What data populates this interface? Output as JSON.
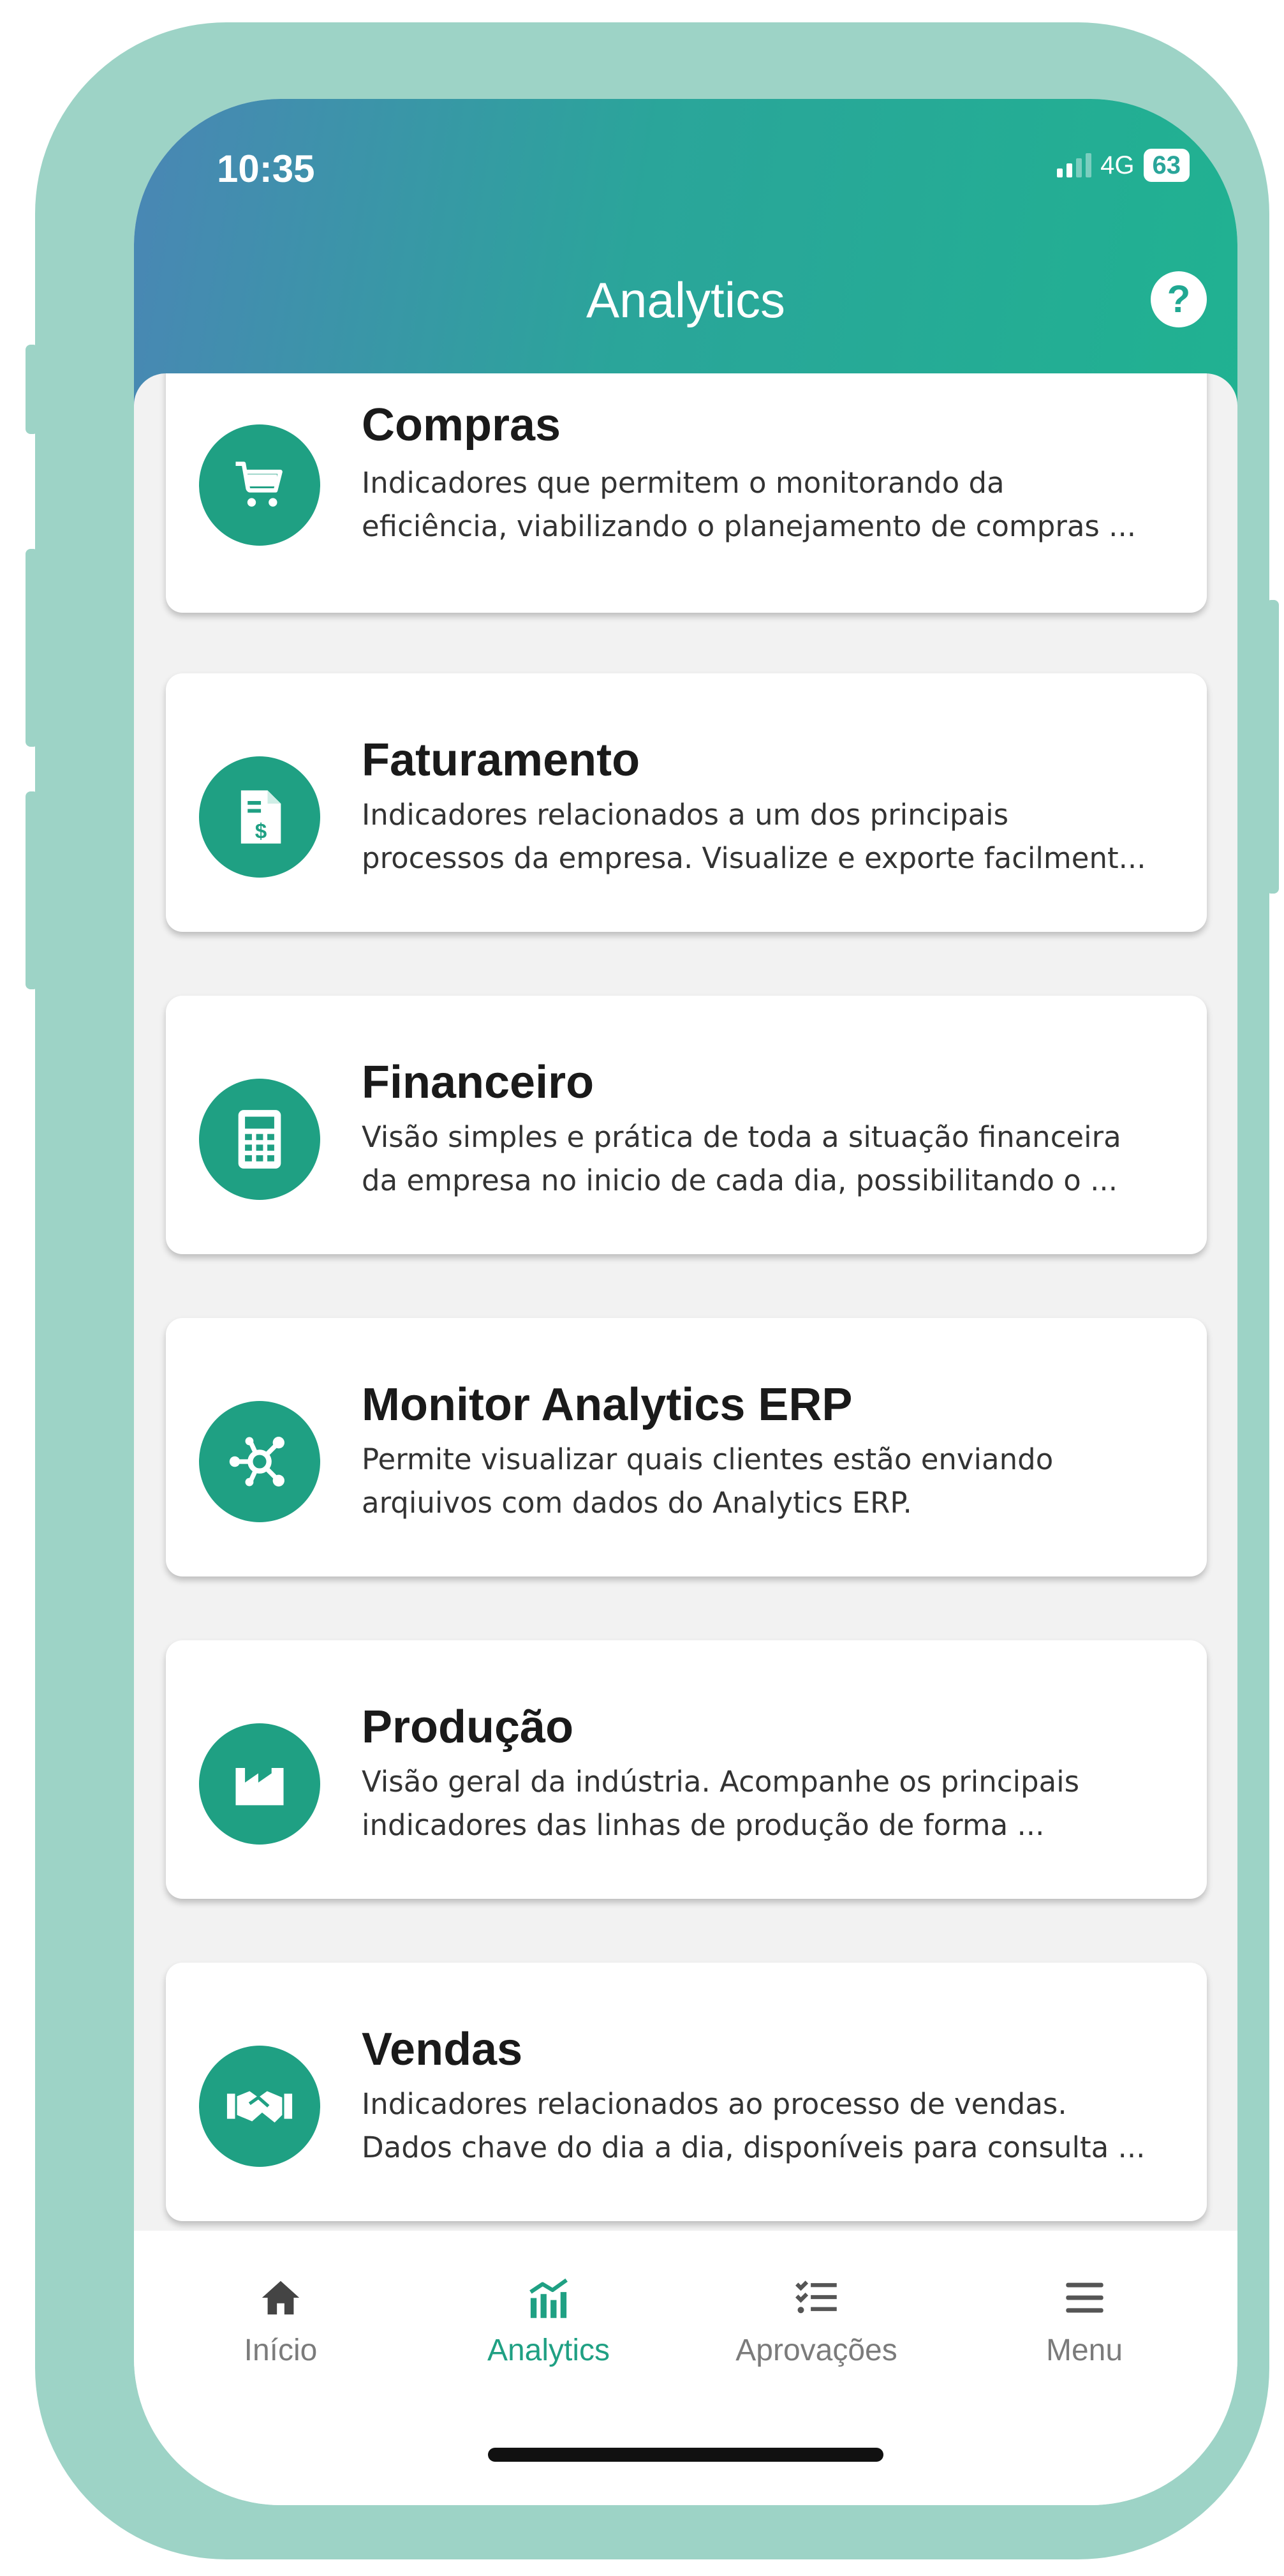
{
  "status_bar": {
    "time": "10:35",
    "network": "4G",
    "battery": "63"
  },
  "header": {
    "title": "Analytics",
    "help_label": "?"
  },
  "modules": [
    {
      "title": "Compras",
      "desc_line1": "Indicadores que permitem o monitorando da",
      "desc_line2": "eficiência, viabilizando o planejamento de compras ...",
      "icon": "cart-icon"
    },
    {
      "title": "Faturamento",
      "desc_line1": "Indicadores relacionados a um dos principais",
      "desc_line2": "processos da empresa. Visualize e exporte facilment...",
      "icon": "invoice-icon"
    },
    {
      "title": "Financeiro",
      "desc_line1": "Visão simples e prática de toda a situação financeira",
      "desc_line2": "da empresa no inicio de cada dia, possibilitando o ...",
      "icon": "calculator-icon"
    },
    {
      "title": "Monitor Analytics ERP",
      "desc_line1": "Permite visualizar quais clientes estão enviando",
      "desc_line2": "arqiuivos com dados do Analytics ERP.",
      "icon": "hub-icon"
    },
    {
      "title": "Produção",
      "desc_line1": "Visão geral da indústria. Acompanhe os principais",
      "desc_line2": "indicadores das linhas de produção de forma ...",
      "icon": "factory-icon"
    },
    {
      "title": "Vendas",
      "desc_line1": "Indicadores relacionados ao processo de vendas.",
      "desc_line2": "Dados chave do dia a dia, disponíveis para consulta ...",
      "icon": "handshake-icon"
    }
  ],
  "bottom_nav": [
    {
      "label": "Início",
      "icon": "home-icon",
      "active": false
    },
    {
      "label": "Analytics",
      "icon": "analytics-icon",
      "active": true
    },
    {
      "label": "Aprovações",
      "icon": "checklist-icon",
      "active": false
    },
    {
      "label": "Menu",
      "icon": "hamburger-icon",
      "active": false
    }
  ],
  "colors": {
    "accent": "#1fa083",
    "frame": "#9dd3c6",
    "header_start": "#4a86b5",
    "header_end": "#20b291"
  }
}
